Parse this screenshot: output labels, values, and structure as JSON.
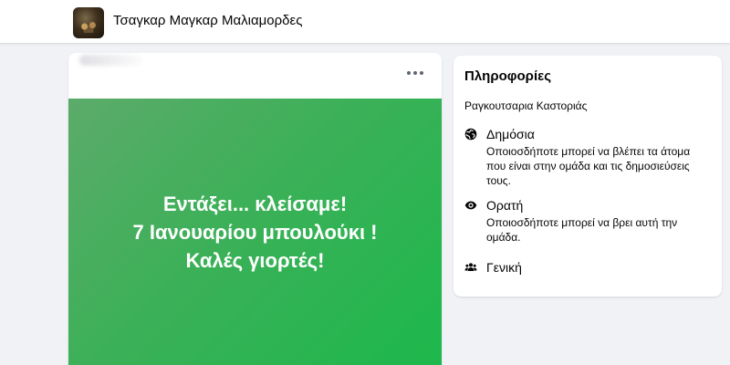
{
  "header": {
    "group_name": "Τσαγκαρ Μαγκαρ Μαλιαμορδες",
    "avatar_icon": "group-photo-avatar"
  },
  "post": {
    "more_icon": "more-horizontal-icon",
    "image_background": "#3cb058",
    "text_lines": [
      "Εντάξει... κλείσαμε!",
      "7 Ιανουαρίου μπουλούκι !",
      "Καλές γιορτές!"
    ]
  },
  "info": {
    "title": "Πληροφορίες",
    "description": "Ραγκουτσαρια Καστοριάς",
    "items": [
      {
        "icon": "globe-icon",
        "label": "Δημόσια",
        "description": "Οποιοσδήποτε μπορεί να βλέπει τα άτομα που είναι στην ομάδα και τις δημοσιεύσεις τους."
      },
      {
        "icon": "eye-icon",
        "label": "Ορατή",
        "description": "Οποιοσδήποτε μπορεί να βρει αυτή την ομάδα."
      },
      {
        "icon": "people-icon",
        "label": "Γενική"
      }
    ]
  },
  "colors": {
    "page_background": "#f0f2f5",
    "card_background": "#ffffff",
    "post_green": "#3cb058",
    "text": "#050505"
  }
}
